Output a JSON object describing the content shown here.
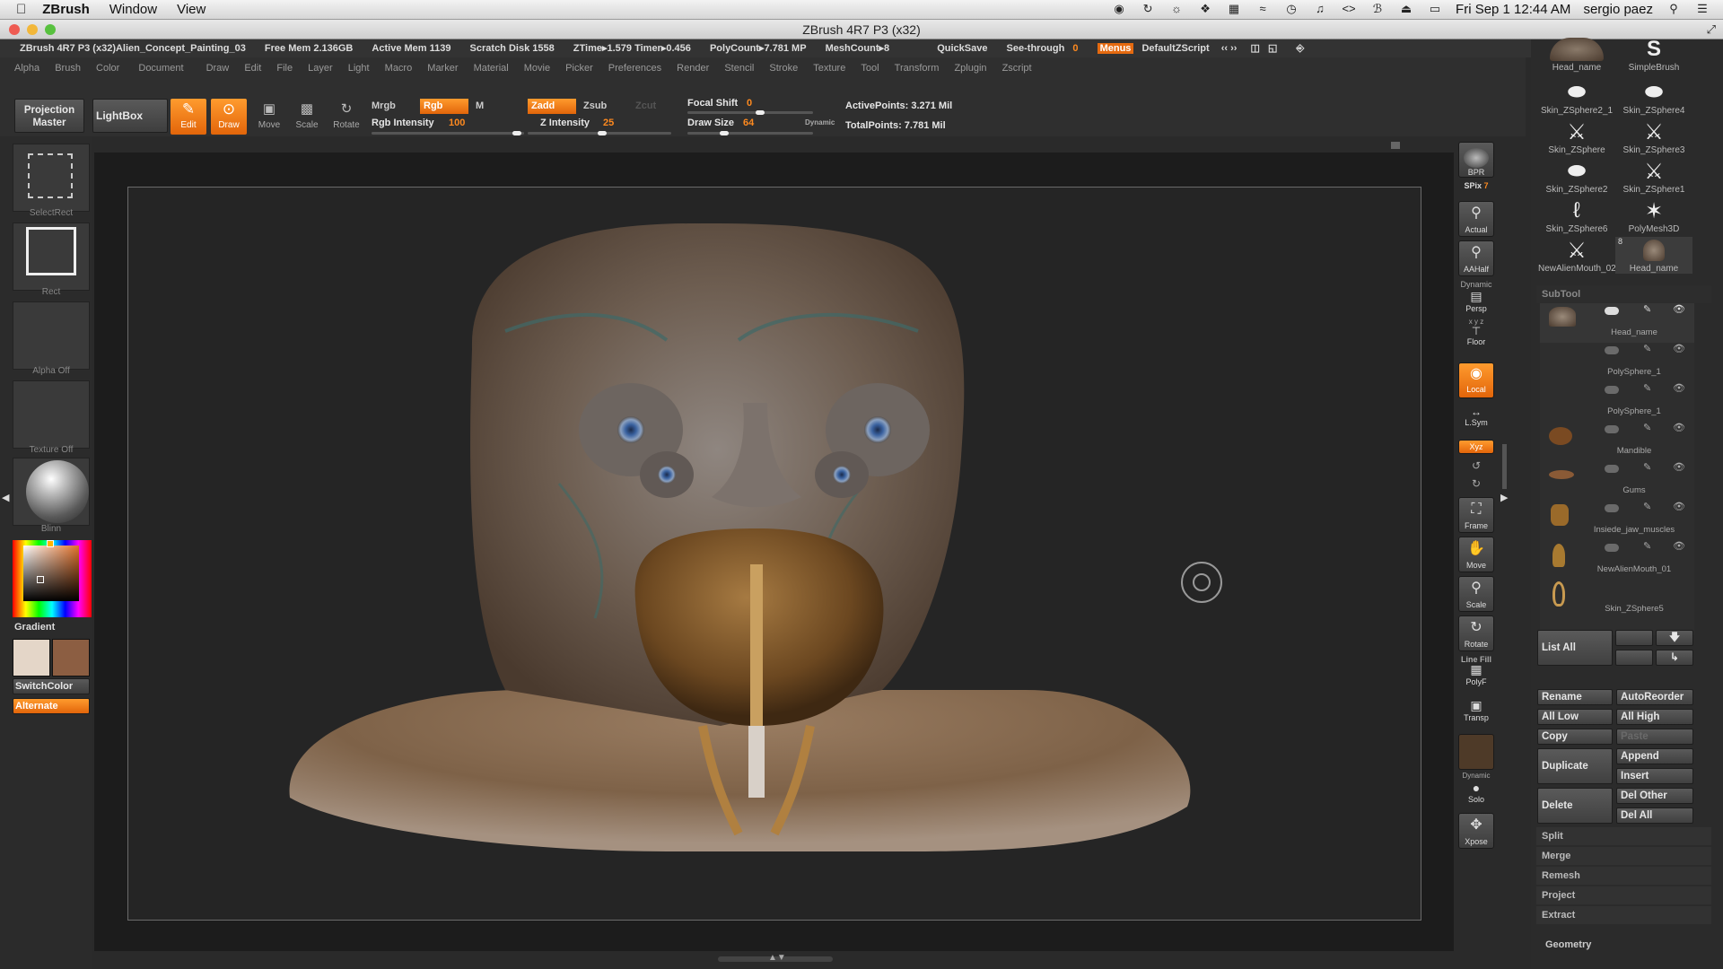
{
  "macbar": {
    "app": "ZBrush",
    "menus": [
      "Window",
      "View"
    ],
    "clock": "Fri Sep 1  12:44 AM",
    "user": "sergio paez"
  },
  "window": {
    "title": "ZBrush 4R7 P3 (x32)"
  },
  "info": {
    "doc": "ZBrush 4R7 P3 (x32)Alien_Concept_Painting_03",
    "items": [
      "Free Mem 2.136GB",
      "Active Mem 1139",
      "Scratch Disk 1558",
      "ZTime▸1.579 Timer▸0.456",
      "PolyCount▸7.781 MP",
      "MeshCount▸8"
    ],
    "quicksave": "QuickSave",
    "seethrough": "See-through",
    "seethrough_val": "0",
    "menus_btn": "Menus",
    "script": "DefaultZScript"
  },
  "menus": [
    "Alpha",
    "Brush",
    "Color",
    "Document",
    "Draw",
    "Edit",
    "File",
    "Layer",
    "Light",
    "Macro",
    "Marker",
    "Material",
    "Movie",
    "Picker",
    "Preferences",
    "Render",
    "Stencil",
    "Stroke",
    "Texture",
    "Tool",
    "Transform",
    "Zplugin",
    "Zscript"
  ],
  "toolbar": {
    "projection_master": "Projection Master",
    "lightbox": "LightBox",
    "edit": "Edit",
    "draw": "Draw",
    "move": "Move",
    "scale": "Scale",
    "rotate": "Rotate",
    "mrgb": "Mrgb",
    "rgb": "Rgb",
    "m": "M",
    "rgb_intensity_label": "Rgb Intensity",
    "rgb_intensity_val": "100",
    "zadd": "Zadd",
    "zsub": "Zsub",
    "zcut": "Zcut",
    "z_intensity_label": "Z Intensity",
    "z_intensity_val": "25",
    "focal_shift_label": "Focal Shift",
    "focal_shift_val": "0",
    "draw_size_label": "Draw Size",
    "draw_size_val": "64",
    "dynamic": "Dynamic",
    "active_points": "ActivePoints: 3.271  Mil",
    "total_points": "TotalPoints: 7.781  Mil"
  },
  "leftshelf": {
    "select_rect": "SelectRect",
    "rect": "Rect",
    "alpha": "Alpha  Off",
    "texture": "Texture  Off",
    "material": "Blinn",
    "gradient": "Gradient",
    "switch_color": "SwitchColor",
    "alternate": "Alternate"
  },
  "righttools": {
    "bpr": "BPR",
    "spix": "SPix",
    "spix_val": "7",
    "actual": "Actual",
    "aahalf": "AAHalf",
    "dynamic": "Dynamic",
    "persp": "Persp",
    "xyz_small": "x y z",
    "floor": "Floor",
    "local": "Local",
    "lsym": "L.Sym",
    "xyz": "Xyz",
    "frame": "Frame",
    "move": "Move",
    "scale": "Scale",
    "rotate": "Rotate",
    "linefill": "Line Fill",
    "polyf": "PolyF",
    "transp": "Transp",
    "dynamic2": "Dynamic",
    "solo": "Solo",
    "xpose": "Xpose"
  },
  "toolpalette": {
    "items": [
      {
        "label": "Head_name",
        "icon": "head-thumb-icon"
      },
      {
        "label": "SimpleBrush",
        "icon": "s-brush-icon"
      },
      {
        "label": "Skin_ZSphere2_1",
        "icon": "pill-icon"
      },
      {
        "label": "Skin_ZSphere4",
        "icon": "pill-icon"
      },
      {
        "label": "Skin_ZSphere",
        "icon": "zsphere-icon"
      },
      {
        "label": "Skin_ZSphere3",
        "icon": "zsphere-icon"
      },
      {
        "label": "Skin_ZSphere2",
        "icon": "pill-icon"
      },
      {
        "label": "Skin_ZSphere1",
        "icon": "zsphere-icon"
      },
      {
        "label": "Skin_ZSphere6",
        "icon": "hook-icon"
      },
      {
        "label": "PolyMesh3D",
        "icon": "star-icon"
      },
      {
        "label": "NewAlienMouth_02",
        "icon": "zsphere-icon"
      },
      {
        "label": "Head_name",
        "icon": "head-thumb-icon"
      }
    ],
    "badge": "8"
  },
  "subtool": {
    "title": "SubTool",
    "items": [
      "Head_name",
      "PolySphere_1",
      "PolySphere_1",
      "Mandible",
      "Gums",
      "Insiede_jaw_muscles",
      "NewAlienMouth_01",
      "Skin_ZSphere5"
    ],
    "list_all": "List  All",
    "rename": "Rename",
    "autoreorder": "AutoReorder",
    "all_low": "All  Low",
    "all_high": "All  High",
    "copy": "Copy",
    "paste": "Paste",
    "duplicate": "Duplicate",
    "append": "Append",
    "insert": "Insert",
    "delete": "Delete",
    "del_other": "Del  Other",
    "del_all": "Del  All",
    "split": "Split",
    "merge": "Merge",
    "remesh": "Remesh",
    "project": "Project",
    "extract": "Extract",
    "geometry": "Geometry"
  },
  "colors": {
    "accent": "#ff8a1f",
    "primary_swatch": "#e4d6c8",
    "secondary_swatch": "#8c5e42"
  }
}
